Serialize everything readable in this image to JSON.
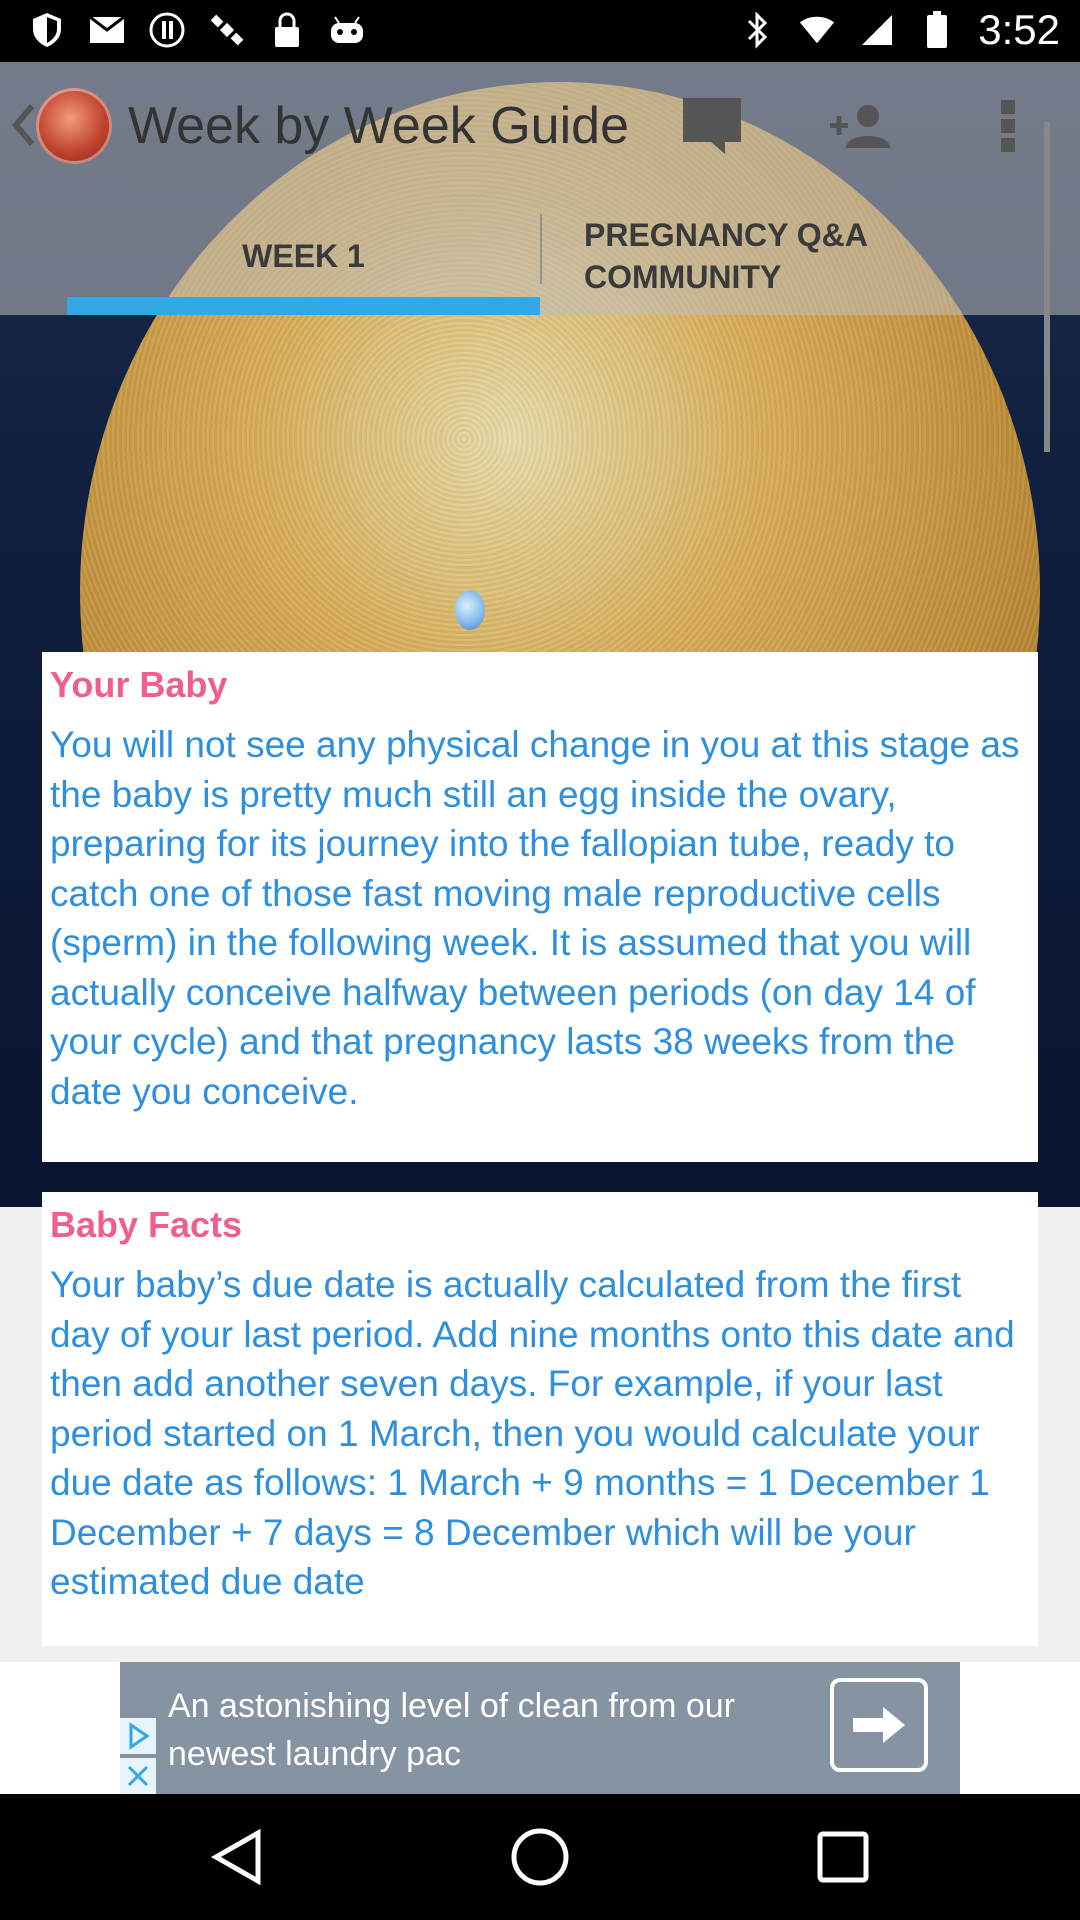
{
  "status_bar": {
    "time": "3:52",
    "left_icons": [
      "shield-icon",
      "mail-icon",
      "alert-circle-icon",
      "satellite-icon",
      "lock-icon",
      "android-icon"
    ],
    "right_icons": [
      "bluetooth-icon",
      "wifi-icon",
      "signal-icon",
      "battery-icon"
    ]
  },
  "app_bar": {
    "title": "Week by Week Guide",
    "actions": [
      "chat-icon",
      "add-person-icon",
      "more-vert-icon"
    ]
  },
  "tabs": [
    {
      "label": "WEEK 1",
      "selected": true
    },
    {
      "label": "PREGNANCY Q&A COMMUNITY",
      "selected": false
    }
  ],
  "cards": {
    "your_baby": {
      "heading": "Your Baby",
      "body": "You will not see any physical change in you at this stage as the baby is pretty much still an egg inside the ovary, preparing for its journey into the fallopian tube, ready to catch one of those fast moving male reproductive cells (sperm) in the following week. It is assumed that you will actually conceive halfway between periods (on day 14 of your cycle) and that pregnancy lasts 38 weeks from the date you conceive."
    },
    "baby_facts": {
      "heading": "Baby Facts",
      "body": "Your baby’s due date is actually calculated from the first day of your last period. Add nine months onto this date and then add another seven days. For example, if your last period started on 1 March, then you would calculate your due date as follows: 1 March + 9 months = 1 December 1 December + 7 days = 8 December which will be your estimated due date"
    }
  },
  "ad": {
    "text": "An astonishing level of clean from our newest laundry pac"
  },
  "colors": {
    "heading_pink": "#ef5f8e",
    "body_blue": "#2d8fde",
    "tab_indicator": "#33a8e6",
    "ad_background": "#8593a3"
  }
}
